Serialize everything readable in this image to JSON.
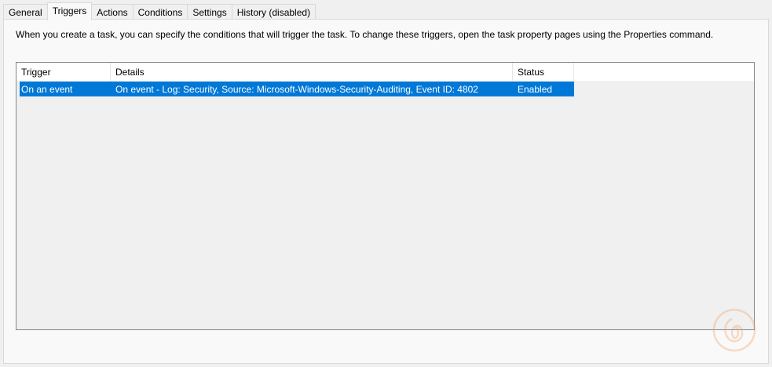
{
  "tabs": [
    {
      "label": "General"
    },
    {
      "label": "Triggers",
      "active": true
    },
    {
      "label": "Actions"
    },
    {
      "label": "Conditions"
    },
    {
      "label": "Settings"
    },
    {
      "label": "History (disabled)"
    }
  ],
  "description": "When you create a task, you can specify the conditions that will trigger the task.  To change these triggers, open the task property pages using the Properties command.",
  "table": {
    "columns": [
      "Trigger",
      "Details",
      "Status"
    ],
    "rows": [
      {
        "trigger": "On an event",
        "details": "On event - Log: Security, Source: Microsoft-Windows-Security-Auditing, Event ID: 4802",
        "status": "Enabled"
      }
    ]
  },
  "colors": {
    "selection": "#0078d7",
    "watermark": "#f0a060"
  },
  "icons": {
    "watermark": "logo-watermark-icon"
  }
}
